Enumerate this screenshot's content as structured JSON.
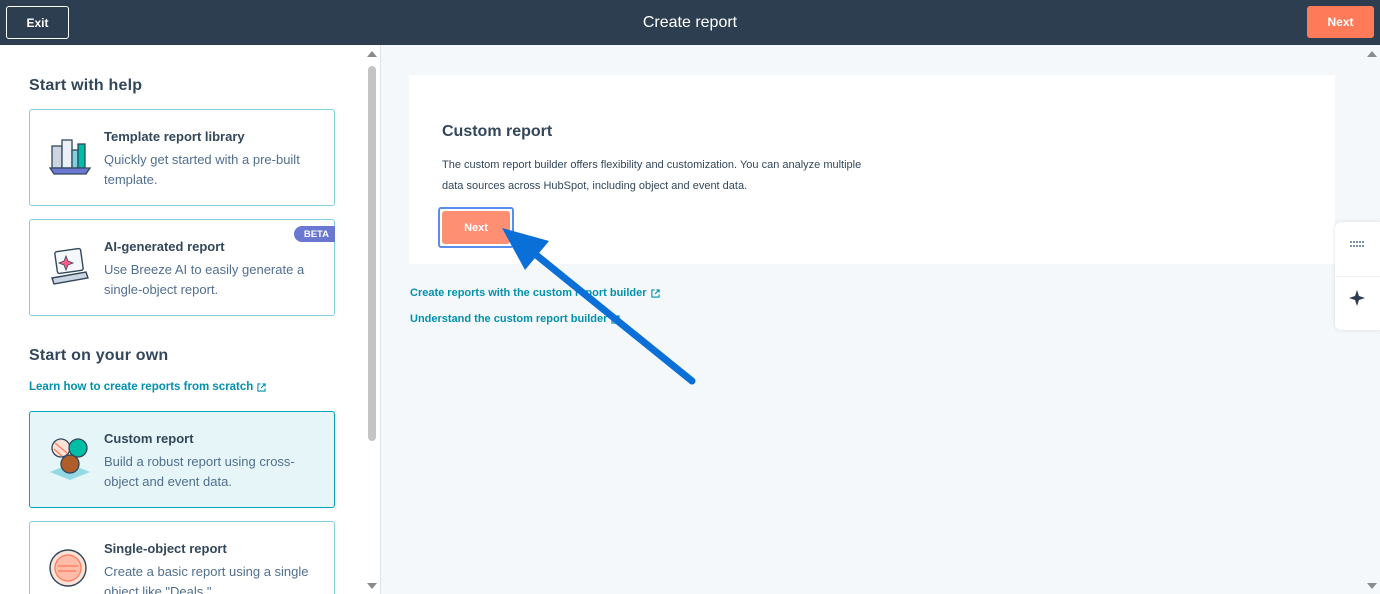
{
  "topbar": {
    "exit_label": "Exit",
    "title": "Create report",
    "next_label": "Next"
  },
  "sidebar": {
    "help_heading": "Start with help",
    "own_heading": "Start on your own",
    "scratch_link": "Learn how to create reports from scratch",
    "cards": [
      {
        "title": "Template report library",
        "desc": "Quickly get started with a pre-built template.",
        "icon": "template-library-icon"
      },
      {
        "title": "AI-generated report",
        "desc": "Use Breeze AI to easily generate a single-object report.",
        "badge": "BETA",
        "icon": "ai-report-icon"
      },
      {
        "title": "Custom report",
        "desc": "Build a robust report using cross-object and event data.",
        "icon": "custom-report-icon",
        "selected": true
      },
      {
        "title": "Single-object report",
        "desc": "Create a basic report using a single object like \"Deals.\"",
        "icon": "single-object-icon"
      }
    ]
  },
  "main": {
    "title": "Custom report",
    "description": "The custom report builder offers flexibility and customization. You can analyze multiple data sources across HubSpot, including object and event data.",
    "next_label": "Next",
    "links": [
      "Create reports with the custom report builder",
      "Understand the custom report builder"
    ]
  },
  "colors": {
    "topbar": "#2d3e50",
    "accent": "#ff7a59",
    "link": "#0091ae",
    "selected_card": "#e5f5f8",
    "beta_badge": "#6a78d1",
    "annotation_arrow": "#0a6fd6"
  },
  "tools": {
    "top_icon": "grid-dots-icon",
    "bottom_icon": "sparkle-icon"
  }
}
